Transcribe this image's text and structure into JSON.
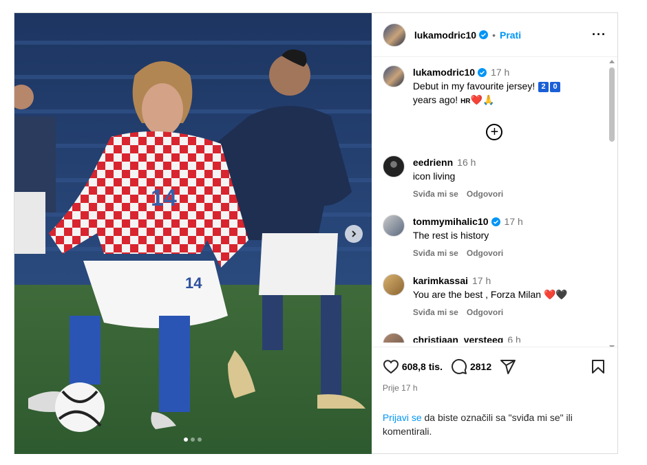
{
  "header": {
    "username": "lukamodric10",
    "separator": "•",
    "follow_label": "Prati",
    "more_label": "···"
  },
  "caption": {
    "username": "lukamodric10",
    "time": "17 h",
    "text_1": "Debut in my favourite jersey!",
    "num_1": "2",
    "num_2": "0",
    "text_2": "years ago!",
    "flag": "HR",
    "emoji": "❤️🙏"
  },
  "comments": [
    {
      "username": "eedrienn",
      "time": "16 h",
      "text": "icon living",
      "like": "Sviđa mi se",
      "reply": "Odgovori",
      "verified": false
    },
    {
      "username": "tommymihalic10",
      "time": "17 h",
      "text": "The rest is history",
      "like": "Sviđa mi se",
      "reply": "Odgovori",
      "verified": true
    },
    {
      "username": "karimkassai",
      "time": "17 h",
      "text": "You are the best , Forza Milan",
      "emoji": "❤️🖤",
      "like": "Sviđa mi se",
      "reply": "Odgovori",
      "verified": false
    },
    {
      "username": "christiaan_versteeg",
      "time": "6 h"
    }
  ],
  "stats": {
    "likes": "608,8 tis.",
    "comments": "2812",
    "posted": "Prije 17 h"
  },
  "login": {
    "link": "Prijavi se",
    "rest": " da biste označili sa \"sviđa mi se\" ili komentirali."
  },
  "carousel": {
    "slides": 3,
    "active": 1
  },
  "colors": {
    "link": "#0095f6",
    "verified": "#0095f6",
    "muted": "#737373",
    "border": "#dbdbdb"
  },
  "icons": [
    "verified-icon",
    "more-icon",
    "add-comment-icon",
    "heart-icon",
    "comment-icon",
    "share-icon",
    "bookmark-icon",
    "chevron-right-icon"
  ]
}
